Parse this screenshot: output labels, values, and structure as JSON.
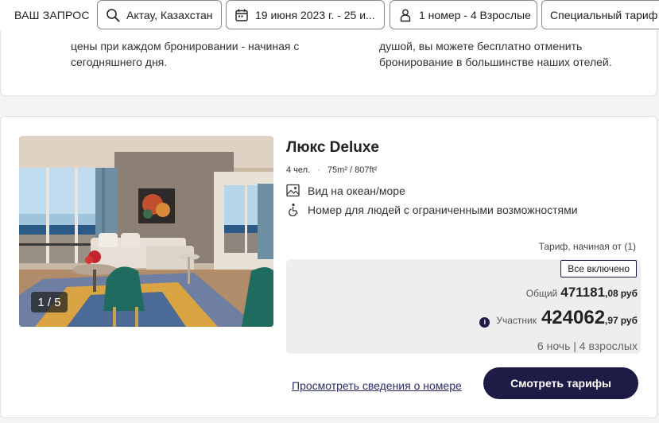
{
  "search": {
    "label": "ВАШ ЗАПРОС",
    "location": "Актау, Казахстан",
    "dates": "19 июня 2023 г. - 25 и...",
    "rooms": "1 номер - 4 Взрослые",
    "rate": "Специальный тариф"
  },
  "top_card": {
    "left_text": "цены при каждом бронировании - начиная с сегодняшнего дня.",
    "right_text": "душой, вы можете бесплатно отменить бронирование в большинстве наших отелей."
  },
  "room": {
    "photo_counter": "1 / 5",
    "title": "Люкс Deluxe",
    "guests": "4 чел.",
    "separator": "·",
    "area": "75m² / 807ft²",
    "features": [
      {
        "icon": "image-icon",
        "text": "Вид на океан/море"
      },
      {
        "icon": "accessibility-icon",
        "text": "Номер для людей с ограниченными возможностями"
      }
    ],
    "rate_from": "Тариф, начиная от (1)",
    "badge": "Все включено",
    "total_label": "Общий",
    "total_price": "471181",
    "total_cents": ",08",
    "currency": "руб",
    "member_label": "Участник",
    "member_price": "424062",
    "member_cents": ",97",
    "info_glyph": "i",
    "stay": "6 ночь | 4 взрослых",
    "details_link": "Просмотреть сведения о номере",
    "rates_button": "Смотреть тарифы"
  },
  "colors": {
    "brand": "#1f1b47",
    "price_box": "#eeeeee",
    "page_bg": "#f3f3f3"
  }
}
